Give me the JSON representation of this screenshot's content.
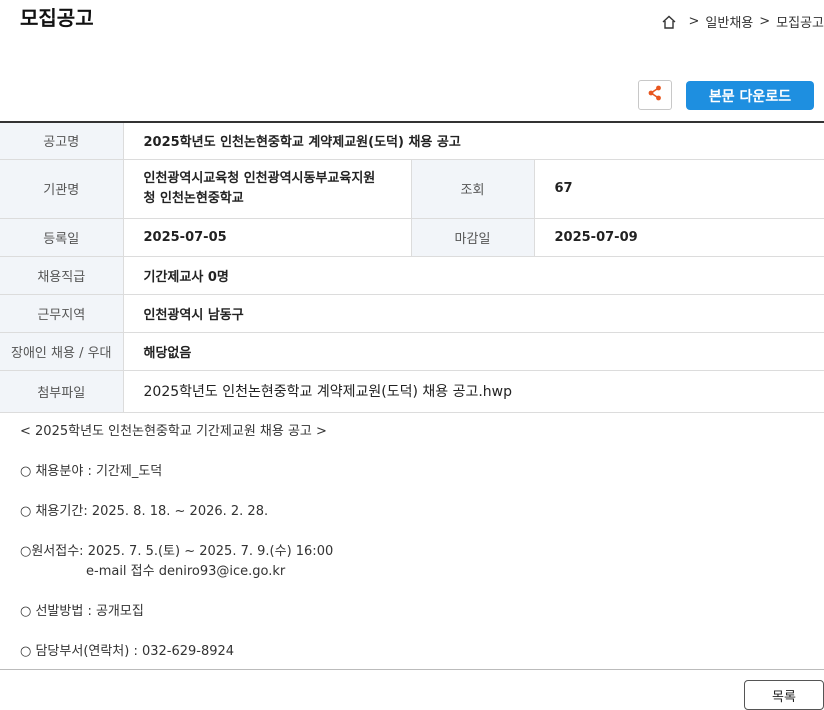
{
  "header": {
    "title": "모집공고",
    "breadcrumb": [
      "일반채용",
      "모집공고"
    ]
  },
  "actions": {
    "share_icon": "share-icon",
    "download_label": "본문 다운로드",
    "list_label": "목록"
  },
  "colors": {
    "accent": "#1e8fe0",
    "share_icon": "#e8561f",
    "label_bg": "#f2f5f9"
  },
  "info": {
    "title_label": "공고명",
    "title_value": "2025학년도 인천논현중학교 계약제교원(도덕) 채용 공고",
    "org_label": "기관명",
    "org_value_line1": "인천광역시교육청 인천광역시동부교육지원",
    "org_value_line2": "청 인천논현중학교",
    "views_label": "조회",
    "views_value": "67",
    "reg_label": "등록일",
    "reg_value": "2025-07-05",
    "deadline_label": "마감일",
    "deadline_value": "2025-07-09",
    "rank_label": "채용직급",
    "rank_value": "기간제교사 0명",
    "region_label": "근무지역",
    "region_value": "인천광역시 남동구",
    "disabled_label": "장애인 채용 / 우대",
    "disabled_value": "해당없음",
    "attach_label": "첨부파일",
    "attach_value": "2025학년도 인천논현중학교 계약제교원(도덕) 채용 공고.hwp"
  },
  "content": {
    "heading": "< 2025학년도 인천논현중학교 기간제교원 채용 공고 >",
    "field": "○ 채용분야 : 기간제_도덕",
    "period": "○ 채용기간: 2025. 8. 18. ~ 2026. 2. 28.",
    "apply": "○원서접수: 2025. 7. 5.(토) ~ 2025. 7. 9.(수) 16:00",
    "apply_email": "e-mail 접수 deniro93@ice.go.kr",
    "method": "○ 선발방법 : 공개모집",
    "contact": "○ 담당부서(연락처) : 032-629-8924"
  }
}
